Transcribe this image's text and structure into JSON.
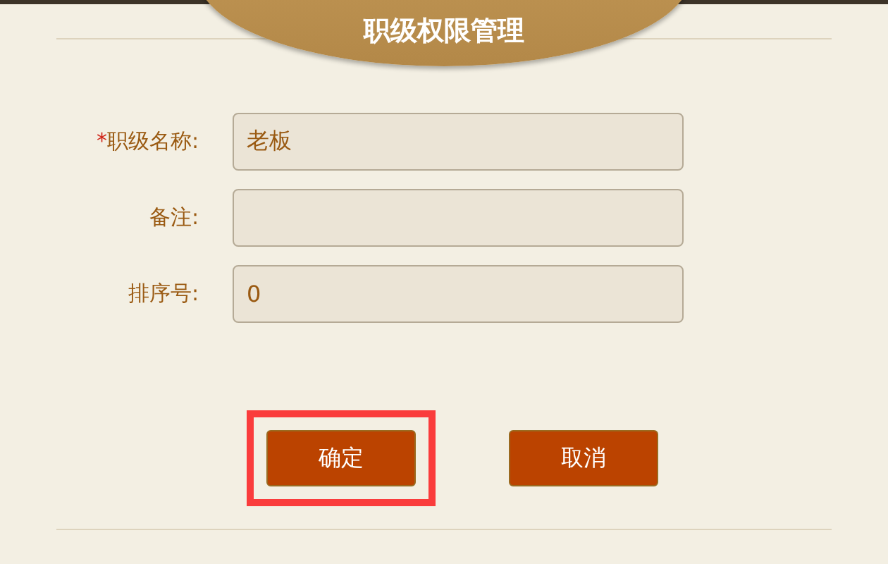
{
  "dialog": {
    "title": "职级权限管理"
  },
  "fields": [
    {
      "marker": "*",
      "label": "职级名称:",
      "value": "老板"
    },
    {
      "label": "备注:"
    },
    {
      "label": "排序号:",
      "value": "0"
    }
  ],
  "buttons": [
    {
      "label": "确定",
      "highlighted": true
    },
    {
      "label": "取消",
      "highlighted": false
    }
  ]
}
